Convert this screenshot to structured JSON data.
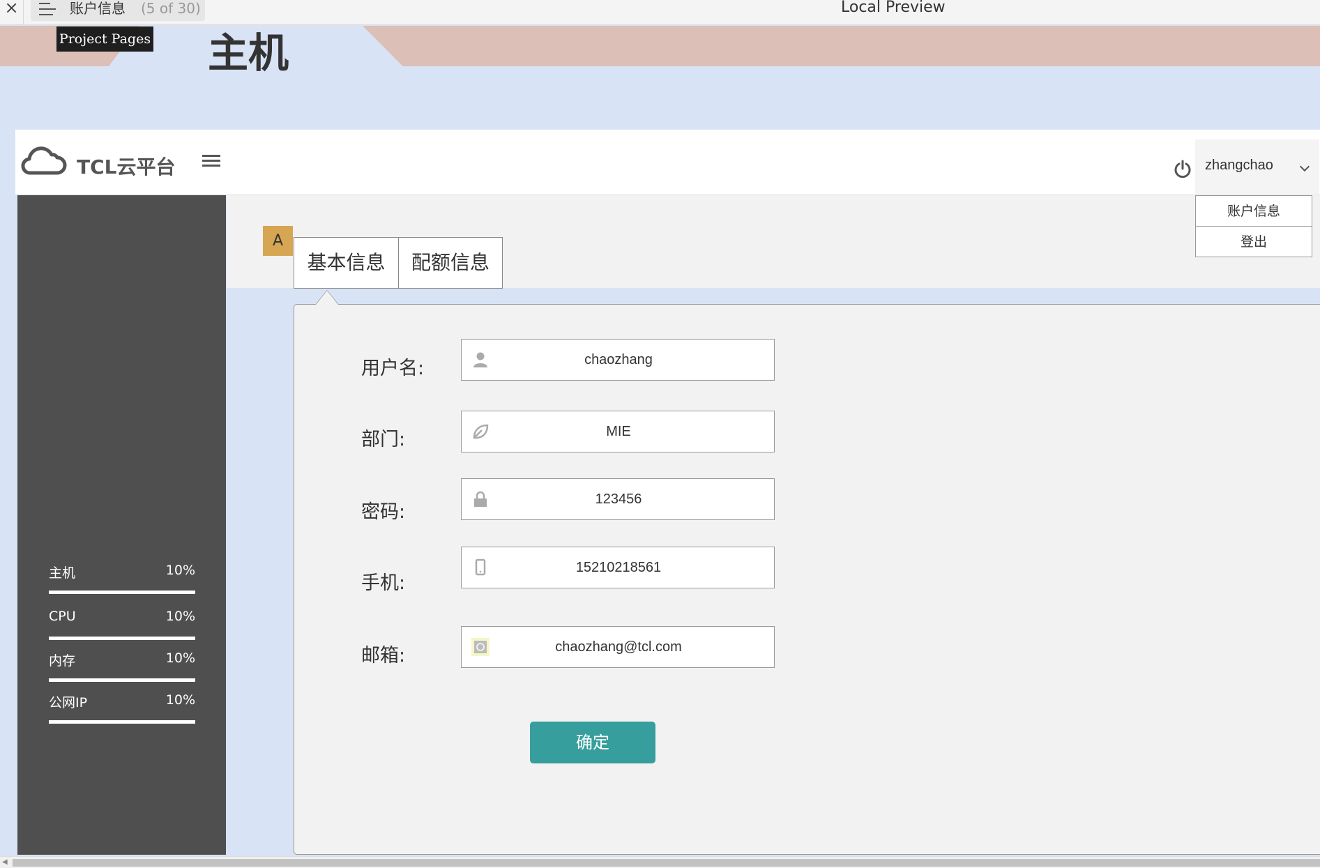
{
  "topbar": {
    "close": "×",
    "page_name": "账户信息",
    "page_count": "(5 of 30)",
    "preview_title": "Local Preview",
    "tooltip": "Project Pages"
  },
  "banner": {
    "title": "主机"
  },
  "header": {
    "logo_text": "TCL云平台",
    "username": "zhangchao",
    "dropdown": [
      {
        "label": "账户信息"
      },
      {
        "label": "登出"
      }
    ]
  },
  "sidebar": {
    "stats": [
      {
        "label": "主机",
        "value": "10%"
      },
      {
        "label": "CPU",
        "value": "10%"
      },
      {
        "label": "内存",
        "value": "10%"
      },
      {
        "label": "公网IP",
        "value": "10%"
      }
    ]
  },
  "content": {
    "badge": "A",
    "tabs": [
      {
        "label": "基本信息"
      },
      {
        "label": "配额信息"
      }
    ],
    "fields": [
      {
        "label": "用户名:",
        "value": "chaozhang",
        "icon": "user-icon"
      },
      {
        "label": "部门:",
        "value": "MIE",
        "icon": "leaf-icon"
      },
      {
        "label": "密码:",
        "value": "123456",
        "icon": "lock-icon"
      },
      {
        "label": "手机:",
        "value": "15210218561",
        "icon": "phone-icon"
      },
      {
        "label": "邮箱:",
        "value": "chaozhang@tcl.com",
        "icon": "email-icon"
      }
    ],
    "confirm_label": "确定"
  },
  "colors": {
    "accent": "#369e9c",
    "sidebar_bg": "#4f4f4f",
    "badge": "#d6a652",
    "banner": "#dcbfb6",
    "page_bg": "#d8e3f5"
  }
}
